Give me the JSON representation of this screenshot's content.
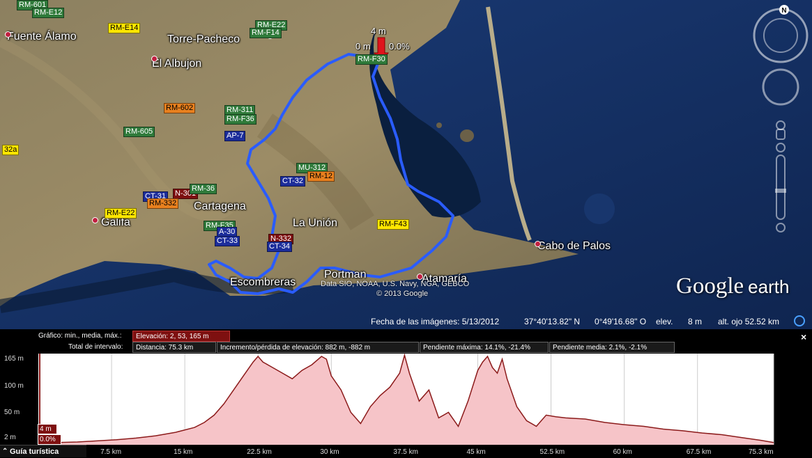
{
  "map": {
    "places": [
      {
        "id": "fuente-alamo",
        "text": "Fuente Álamo"
      },
      {
        "id": "torre-pacheco",
        "text": "Torre-Pacheco"
      },
      {
        "id": "el-albujon",
        "text": "El Albujon"
      },
      {
        "id": "cartagena",
        "text": "Cartagena"
      },
      {
        "id": "la-union",
        "text": "La Unión"
      },
      {
        "id": "galifa",
        "text": "Galifa"
      },
      {
        "id": "escombreras",
        "text": "Escombreras"
      },
      {
        "id": "portman",
        "text": "Portman"
      },
      {
        "id": "atamaria",
        "text": "Atamaría"
      },
      {
        "id": "cabo-de-palos",
        "text": "Cabo de Palos"
      }
    ],
    "shields": [
      "RM-601",
      "RM-E12",
      "RM-E14",
      "RM-E22",
      "RM-F14",
      "RM-F30",
      "RM-602",
      "RM-311",
      "RM-F36",
      "AP-7",
      "RM-605",
      "32a",
      "MU-312",
      "RM-12",
      "CT-32",
      "CT-31",
      "N-301",
      "RM-36",
      "RM-332",
      "RM-E22",
      "RM-F35",
      "A-30",
      "CT-33",
      "N-332",
      "CT-34",
      "RM-F43"
    ],
    "marker": {
      "distance": "0 m",
      "elevation": "4 m",
      "grade": "0.0%"
    },
    "credits": {
      "line1": "Data SIO, NOAA, U.S. Navy, NGA, GEBCO",
      "line2": "© 2013 Google"
    },
    "logo": {
      "google": "Google",
      "earth": "earth"
    },
    "compass_letter": "N",
    "colors": {
      "route": "#2a5cff",
      "profile_fill": "#f6c4c8",
      "profile_line": "#8b1a1a"
    }
  },
  "status": {
    "imagery_date": "Fecha de las imágenes: 5/13/2012",
    "lat": "37°40'13.82\" N",
    "lon": "0°49'16.68\" O",
    "elev_label": "elev.",
    "elev_value": "8 m",
    "eye_alt": "alt. ojo  52.52 km"
  },
  "profile": {
    "graph_label": "Gráfico: min., media, máx.:",
    "elevation": "Elevación: 2, 53, 165 m",
    "interval_label": "Total de intervalo:",
    "distance": "Distancia: 75.3 km",
    "gain_loss": "Incremento/pérdida de elevación: 882 m, -882 m",
    "max_slope": "Pendiente máxima: 14.1%, -21.4%",
    "avg_slope": "Pendiente media: 2.1%, -2.1%",
    "cursor_elev": "4 m",
    "cursor_grade": "0.0%",
    "tour_button": "Guía turística",
    "close": "×"
  },
  "chart_data": {
    "type": "area",
    "x_unit": "km",
    "y_unit": "m",
    "xlim": [
      0,
      75.3
    ],
    "ylim": [
      2,
      165
    ],
    "y_ticks": [
      "165 m",
      "100 m",
      "50 m",
      "2 m"
    ],
    "x_ticks": [
      "7.5 km",
      "15 km",
      "22.5 km",
      "30 km",
      "37.5 km",
      "45 km",
      "52.5 km",
      "60 km",
      "67.5 km",
      "75.3 km"
    ],
    "x": [
      0,
      2,
      4,
      6,
      8,
      10,
      12,
      14,
      16,
      17,
      18,
      19,
      20,
      21,
      22,
      22.5,
      23,
      24,
      25,
      26,
      27,
      28,
      29,
      29.5,
      30,
      31,
      32,
      33,
      34,
      35,
      36,
      37,
      37.5,
      38,
      39,
      40,
      41,
      42,
      43,
      44,
      45,
      45.5,
      46,
      46.5,
      47,
      47.5,
      48,
      49,
      50,
      51,
      52,
      53,
      54,
      56,
      58,
      60,
      62,
      64,
      66,
      68,
      70,
      72,
      74,
      75.3
    ],
    "y": [
      5,
      6,
      7,
      9,
      11,
      14,
      18,
      24,
      33,
      42,
      55,
      75,
      100,
      125,
      150,
      160,
      150,
      140,
      130,
      120,
      135,
      145,
      160,
      155,
      125,
      100,
      60,
      40,
      70,
      90,
      105,
      130,
      162,
      130,
      80,
      100,
      50,
      60,
      35,
      80,
      135,
      150,
      160,
      140,
      130,
      155,
      120,
      70,
      45,
      35,
      55,
      52,
      50,
      48,
      42,
      38,
      35,
      30,
      27,
      23,
      20,
      15,
      10,
      6
    ]
  }
}
